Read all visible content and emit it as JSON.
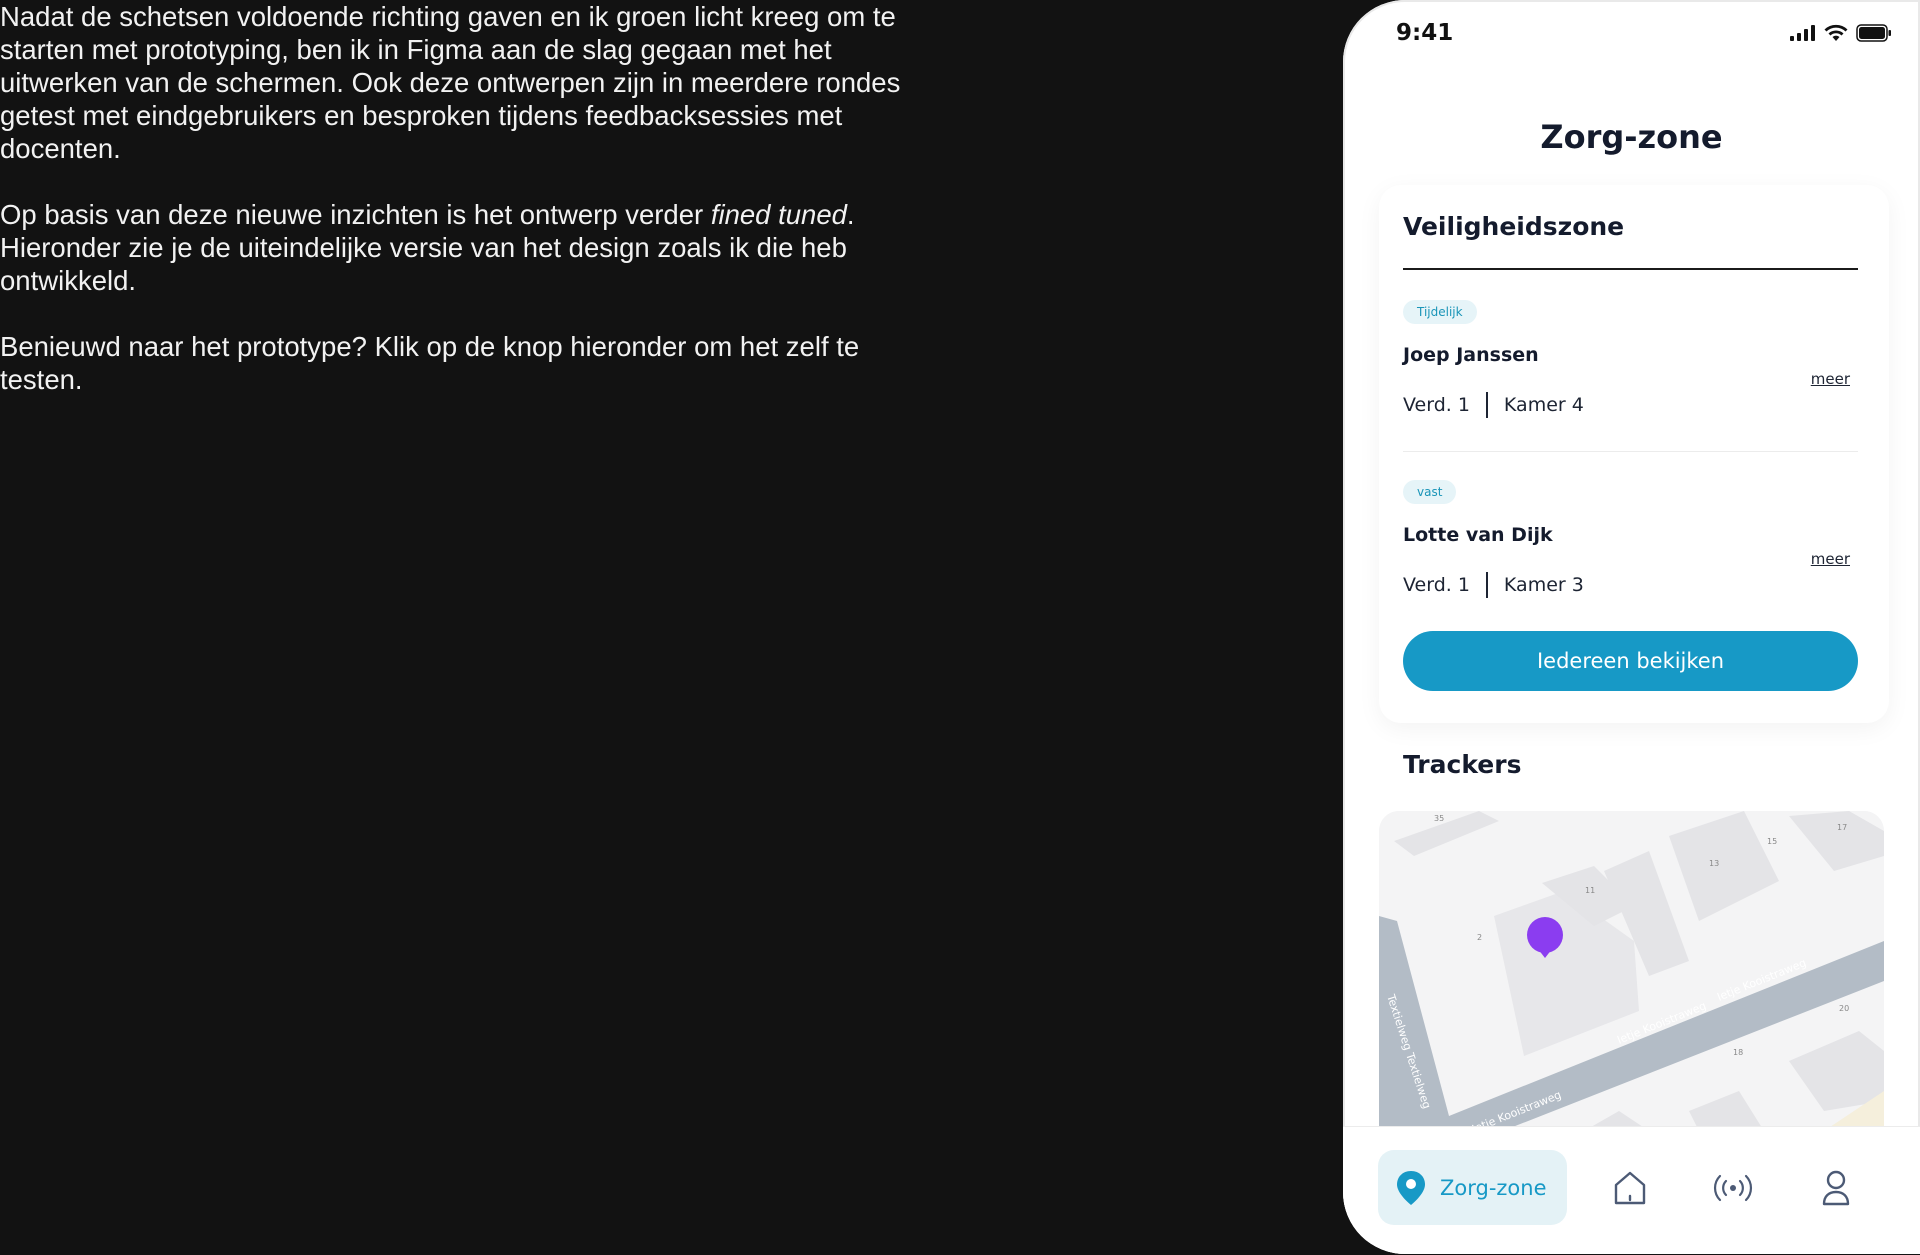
{
  "intro": {
    "p1": "Nadat de schetsen voldoende richting gaven en ik groen licht kreeg om te starten met prototyping, ben ik in Figma aan de slag gegaan met het uitwerken van de schermen. Ook deze ontwerpen zijn in meerdere rondes getest met eindgebruikers en besproken tijdens feedbacksessies met docenten.",
    "p2_before": "Op basis van deze nieuwe inzichten is het ontwerp verder ",
    "p2_italic": "fined tuned",
    "p2_after": ". Hieronder zie je de uiteindelijke versie van het design zoals ik die heb ontwikkeld.",
    "p3": "Benieuwd naar het prototype? Klik op de knop hieronder om het zelf te testen."
  },
  "phone": {
    "time": "9:41",
    "title": "Zorg-zone",
    "zone": {
      "title": "Veiligheidszone",
      "people": [
        {
          "badge": "Tijdelijk",
          "name": "Joep Janssen",
          "floor": "Verd. 1",
          "room": "Kamer 4",
          "more": "meer"
        },
        {
          "badge": "vast",
          "name": "Lotte van Dijk",
          "floor": "Verd. 1",
          "room": "Kamer 3",
          "more": "meer"
        }
      ],
      "cta": "Iedereen bekijken"
    },
    "trackers": {
      "title": "Trackers",
      "map_labels": {
        "street_a": "Ietje Kooistraweg",
        "street_b": "Ietje Kooistraweg",
        "street_c": "Ietje Kooistraweg",
        "street_d": "Textielweg Textielweg",
        "n35": "35",
        "n15": "15",
        "n17": "17",
        "n13": "13",
        "n11": "11",
        "n2": "2",
        "n20": "20",
        "n18": "18"
      },
      "marker_color": "#8b3df0"
    },
    "nav": {
      "active_label": "Zorg-zone",
      "items": [
        "location-pin-icon",
        "home-icon",
        "broadcast-icon",
        "user-icon"
      ]
    },
    "accent": "#1799c6"
  }
}
